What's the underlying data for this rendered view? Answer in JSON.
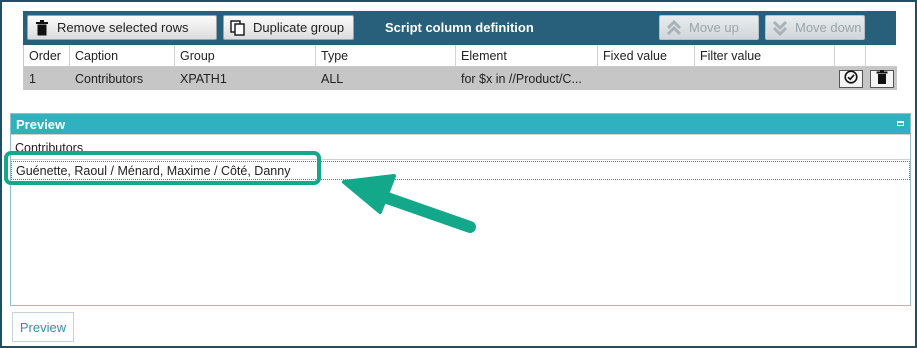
{
  "toolbar": {
    "remove_label": "Remove selected rows",
    "duplicate_label": "Duplicate group",
    "title": "Script column definition",
    "move_up_label": "Move up",
    "move_down_label": "Move down"
  },
  "grid": {
    "columns": [
      "Order",
      "Caption",
      "Group",
      "Type",
      "Element",
      "Fixed value",
      "Filter value"
    ],
    "rows": [
      {
        "order": "1",
        "caption": "Contributors",
        "group": "XPATH1",
        "type": "ALL",
        "element": "for $x in //Product/C...",
        "fixed_value": "",
        "filter_value": ""
      }
    ]
  },
  "preview": {
    "title": "Preview",
    "column_header": "Contributors",
    "value": "Guénette, Raoul / Ménard, Maxime / Côté, Danny"
  },
  "footer": {
    "preview_button_label": "Preview"
  },
  "colors": {
    "toolbar_bg": "#285f7a",
    "preview_header_bg": "#2fb1c0",
    "highlight": "#13a889",
    "selected_row": "#c6c6c6"
  },
  "icons": [
    "trash-icon",
    "duplicate-icon",
    "move-up-icon",
    "move-down-icon",
    "validate-icon",
    "delete-row-icon",
    "pin-icon",
    "callout-arrow"
  ]
}
